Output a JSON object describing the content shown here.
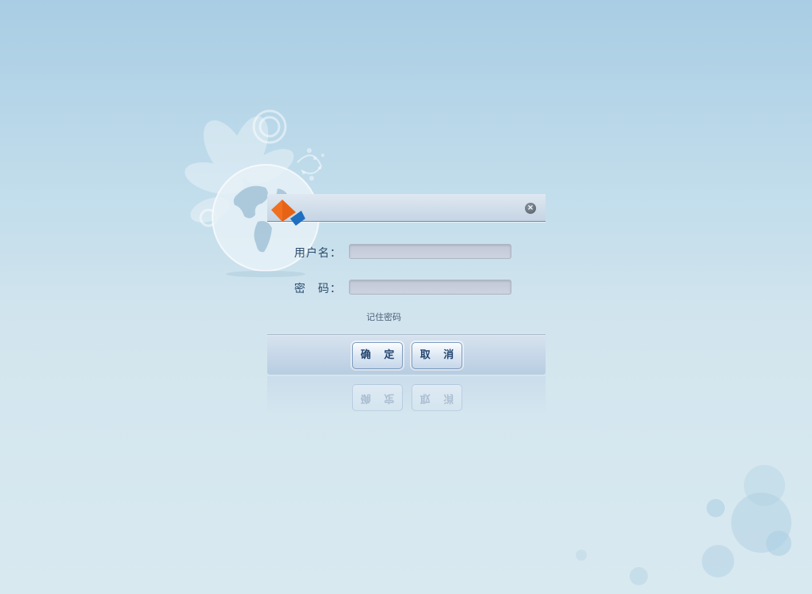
{
  "form": {
    "username_label": "用户名：",
    "username_value": "",
    "password_label": "密　码：",
    "password_value": "",
    "remember_label": "记住密码"
  },
  "buttons": {
    "ok_label": "确 定",
    "cancel_label": "取 消"
  },
  "icons": {
    "close": "close-icon",
    "logo": "app-logo-icon",
    "globe": "globe-flower-decoration"
  },
  "colors": {
    "background_top": "#a9cde4",
    "background_bottom": "#d9e9f0",
    "label": "#2b4a6b",
    "button_text": "#23456f",
    "logo_orange": "#f07020",
    "logo_blue": "#1f6fc0"
  }
}
